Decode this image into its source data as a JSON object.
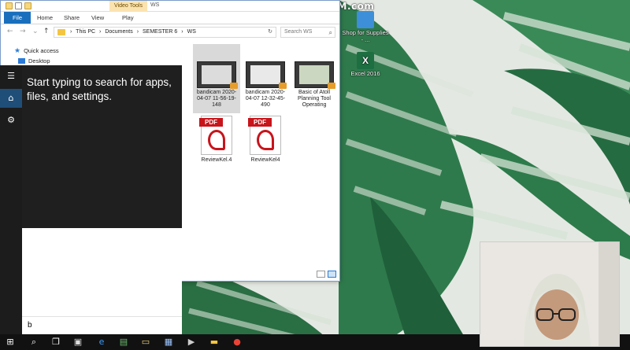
{
  "watermark": "www.BANDICAM.com",
  "desktop_icons": [
    {
      "label": "Shop for Supplies - ...",
      "icon": "shop-icon"
    },
    {
      "label": "Excel 2016",
      "icon": "excel-icon"
    }
  ],
  "explorer": {
    "contextual_tab": "Video Tools",
    "window_title": "WS",
    "ribbon_tabs": [
      "File",
      "Home",
      "Share",
      "View",
      "Play"
    ],
    "breadcrumb": [
      "This PC",
      "Documents",
      "SEMESTER 6",
      "WS"
    ],
    "search_placeholder": "Search WS",
    "nav_items": [
      "Quick access",
      "Desktop"
    ],
    "files": [
      {
        "name": "bandicam 2020-04-07 11-56-19-148",
        "type": "video",
        "selected": true
      },
      {
        "name": "bandicam 2020-04-07 12-32-45-490",
        "type": "video",
        "selected": false
      },
      {
        "name": "Basic of Atoll Planning Tool Operating",
        "type": "video",
        "selected": false
      },
      {
        "name": "ReviewKel.4",
        "type": "pdf",
        "selected": false
      },
      {
        "name": "ReviewKel4",
        "type": "pdf",
        "selected": false
      }
    ]
  },
  "search_panel": {
    "hint": "Start typing to search for apps, files, and settings.",
    "query": "b"
  },
  "colors": {
    "file_tab": "#1a6fbd",
    "start_bg": "#1f1f1f",
    "rail_active": "#1f4e79"
  }
}
